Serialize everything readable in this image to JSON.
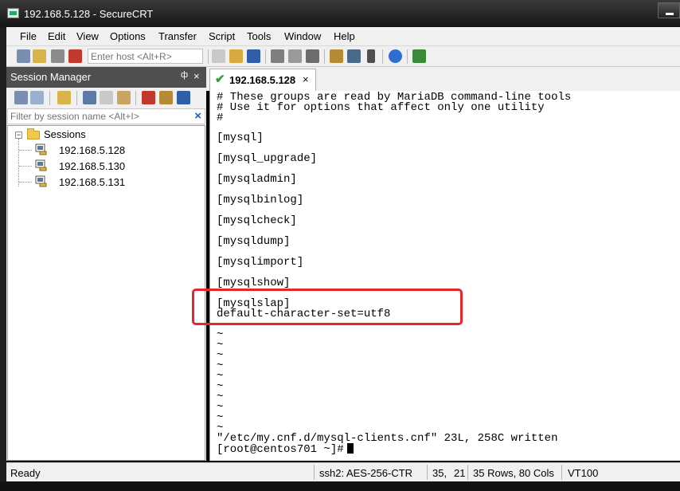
{
  "window": {
    "title": "192.168.5.128 - SecureCRT"
  },
  "menu": [
    "File",
    "Edit",
    "View",
    "Options",
    "Transfer",
    "Script",
    "Tools",
    "Window",
    "Help"
  ],
  "toolbar": {
    "host_placeholder": "Enter host <Alt+R>"
  },
  "session_manager": {
    "title": "Session Manager",
    "pin": "ф",
    "close": "×",
    "filter_placeholder": "Filter by session name <Alt+I>",
    "filter_clear": "×",
    "root": {
      "label": "Sessions",
      "expander": "−"
    },
    "sessions": [
      "192.168.5.128",
      "192.168.5.130",
      "192.168.5.131"
    ]
  },
  "tab": {
    "label": "192.168.5.128",
    "check": "✔",
    "close": "×"
  },
  "terminal": {
    "lines": [
      "# These groups are read by MariaDB command-line tools",
      "# Use it for options that affect only one utility",
      "#",
      "[mysql]",
      "[mysql_upgrade]",
      "[mysqladmin]",
      "[mysqlbinlog]",
      "[mysqlcheck]",
      "[mysqldump]",
      "[mysqlimport]",
      "[mysqlshow]",
      "[mysqlslap]",
      "default-character-set=utf8",
      "~",
      "~",
      "~",
      "~",
      "~",
      "~",
      "~",
      "~",
      "~",
      "~",
      "\"/etc/my.cnf.d/mysql-clients.cnf\" 23L, 258C written",
      "[root@centos701 ~]#"
    ]
  },
  "status": {
    "ready": "Ready",
    "cipher": "ssh2: AES-256-CTR",
    "row": "35,",
    "col": "21",
    "size": "35 Rows, 80 Cols",
    "emulation": "VT100"
  },
  "colors": {
    "highlight_box": "#e8262a",
    "check": "#2e9e2e"
  },
  "icons": [
    "connect-icon",
    "quick-connect-icon",
    "reconnect-icon",
    "disconnect-icon",
    "copy-icon",
    "paste-icon",
    "find-icon",
    "print-icon",
    "print-setup-icon",
    "session-options-icon",
    "global-options-icon",
    "keymap-icon",
    "help-icon",
    "sftp-icon"
  ]
}
